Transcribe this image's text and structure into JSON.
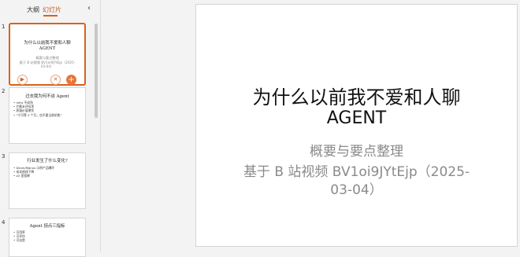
{
  "sidebar": {
    "tabs": [
      {
        "label": "大纲"
      },
      {
        "label": "幻灯片"
      }
    ],
    "active_tab": "幻灯片",
    "collapse_icon": "chevron-left-icon",
    "accent_color": "#d9621c",
    "slides": [
      {
        "number": "1",
        "title_line1": "为什么以前我不爱和人聊",
        "title_line2": "AGENT",
        "sub_line1": "概要与要点整理",
        "sub_line2": "基于 B 站视频 BV1oi9JYtEjp（2025-",
        "sub_line3": "03-04）"
      },
      {
        "number": "2",
        "heading": "过去我为何不谈 Agent",
        "bullets": [
          "Infra 不成熟",
          "拦截未评估项",
          "质量价值堪忧",
          "“宁可等 3 个月，也不要当前机焦”"
        ]
      },
      {
        "number": "3",
        "heading": "行业发生了什么变化?",
        "bullets": [
          "Devin/Manus 示例产品曝环",
          "成本曲线下降",
          "o3 里程碑"
        ]
      },
      {
        "number": "4",
        "heading": "Agent 拐点三指标",
        "bullets": [
          "可用率",
          "可评估",
          "可自愈"
        ]
      }
    ],
    "thumb_actions": [
      {
        "icon": "play-icon"
      },
      {
        "icon": "cross-icon"
      },
      {
        "icon": "plus-icon"
      }
    ]
  },
  "slide": {
    "title_line1": "为什么以前我不爱和人聊",
    "title_line2": "AGENT",
    "sub_line1": "概要与要点整理",
    "sub_line2": "基于 B 站视频 BV1oi9JYtEjp（2025-",
    "sub_line3": "03-04）"
  }
}
